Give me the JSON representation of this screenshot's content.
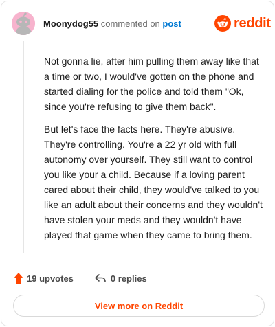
{
  "header": {
    "username": "Moonydog55",
    "action_text": "commented on",
    "post_link": "post",
    "brand": "reddit",
    "brand_color": "#ff4500",
    "avatar_icon": "snoo-avatar-icon",
    "logo_icon": "reddit-snoo-icon"
  },
  "comment": {
    "paragraphs": [
      "Not gonna lie, after him pulling them away like that a time or two, I would've gotten on the phone and started dialing for the police and told them \"Ok, since you're refusing to give them back\".",
      "But let's face the facts here. They're abusive. They're controlling. You're a 22 yr old with full autonomy over yourself. They still want to control you like your a child. Because if a loving parent cared about their child, they would've talked to you like an adult about their concerns and they wouldn't have stolen your meds and they wouldn't have played that game when they came to bring them."
    ]
  },
  "footer": {
    "upvotes": "19 upvotes",
    "replies": "0 replies",
    "upvote_icon": "upvote-arrow-icon",
    "reply_icon": "reply-arrow-icon"
  },
  "cta": {
    "label": "View more on Reddit"
  }
}
